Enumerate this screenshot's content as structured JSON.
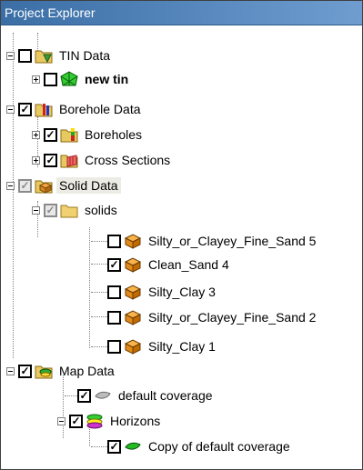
{
  "window": {
    "title": "Project Explorer"
  },
  "tree": [
    {
      "label": "TIN Data",
      "checked": false,
      "icon": "tin-folder-icon"
    },
    {
      "label": "new tin",
      "checked": false,
      "icon": "tin-icon"
    },
    {
      "label": "Borehole Data",
      "checked": true,
      "icon": "borehole-folder-icon"
    },
    {
      "label": "Boreholes",
      "checked": true,
      "icon": "boreholes-icon"
    },
    {
      "label": "Cross Sections",
      "checked": true,
      "icon": "cross-sections-icon"
    },
    {
      "label": "Solid Data",
      "checked": true,
      "icon": "solid-folder-icon"
    },
    {
      "label": "solids",
      "checked": true,
      "icon": "folder-icon"
    },
    {
      "label": "Silty_or_Clayey_Fine_Sand 5",
      "checked": false,
      "icon": "solid-icon"
    },
    {
      "label": "Clean_Sand 4",
      "checked": true,
      "icon": "solid-icon"
    },
    {
      "label": "Silty_Clay 3",
      "checked": false,
      "icon": "solid-icon"
    },
    {
      "label": "Silty_or_Clayey_Fine_Sand 2",
      "checked": false,
      "icon": "solid-icon"
    },
    {
      "label": "Silty_Clay 1",
      "checked": false,
      "icon": "solid-icon"
    },
    {
      "label": "Map Data",
      "checked": true,
      "icon": "map-folder-icon"
    },
    {
      "label": "default coverage",
      "checked": true,
      "icon": "coverage-icon"
    },
    {
      "label": "Horizons",
      "checked": true,
      "icon": "horizons-icon"
    },
    {
      "label": "Copy of default coverage",
      "checked": true,
      "icon": "coverage-copy-icon"
    }
  ]
}
